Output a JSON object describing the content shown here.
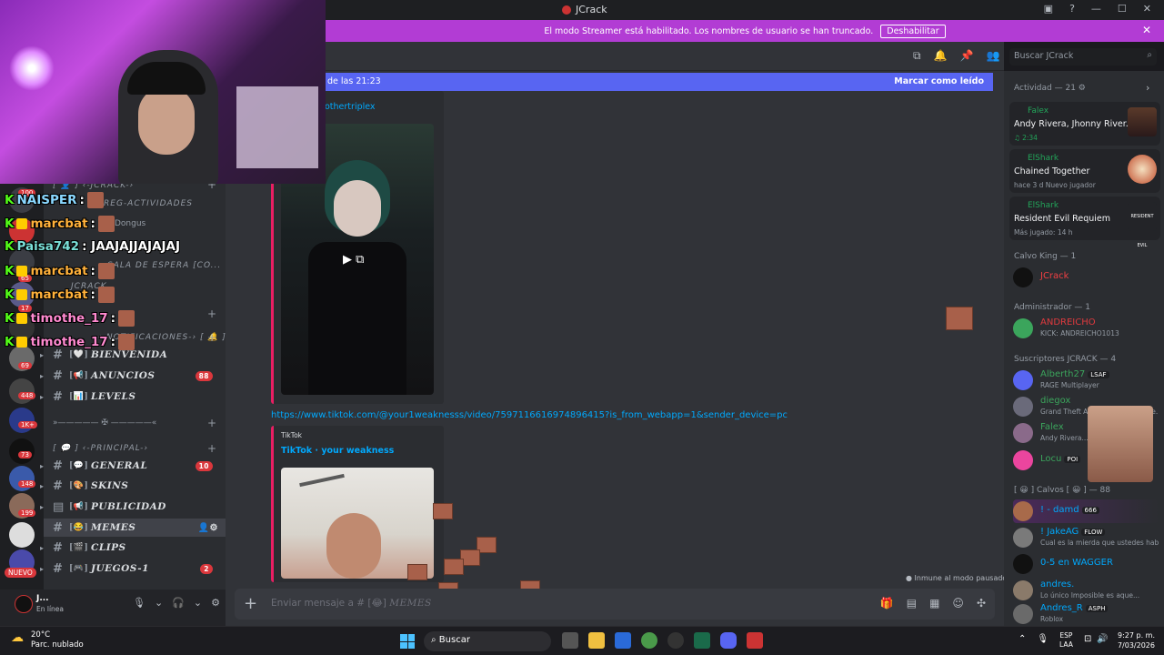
{
  "window": {
    "title": "JCrack"
  },
  "streamer_banner": {
    "text": "El modo Streamer está habilitado. Los nombres de usuario se han truncado.",
    "button": "Deshabilitar"
  },
  "new_messages_bar": {
    "left": "de las 21:23",
    "right": "Marcar como leído"
  },
  "channels": {
    "categories": [
      {
        "label": "[ 👤 ] ‹-JCRACK-›"
      },
      {
        "label": "»————— ✠ —————«"
      },
      {
        "label": "[ 💬 ] ‹-PRINCIPAL-›"
      }
    ],
    "voice": [
      {
        "label": "REG-ACTIVIDADES"
      },
      {
        "label": "Dongus"
      },
      {
        "label": "SALA DE ESPERA [CO..."
      },
      {
        "label": "JCRACK"
      },
      {
        "label": "‹-NOTIFICACIONES-› [ 🔔 ]"
      }
    ],
    "items": [
      {
        "label": "BIENVENIDA",
        "emoji": "[🤍]",
        "badge": ""
      },
      {
        "label": "ANUNCIOS",
        "emoji": "[📢]",
        "badge": "88"
      },
      {
        "label": "LEVELS",
        "emoji": "[📊]",
        "badge": ""
      },
      {
        "label": "GENERAL",
        "emoji": "[💬]",
        "badge": "10"
      },
      {
        "label": "SKINS",
        "emoji": "[🎨]",
        "badge": ""
      },
      {
        "label": "PUBLICIDAD",
        "emoji": "[📢]",
        "badge": ""
      },
      {
        "label": "MEMES",
        "emoji": "[😂]",
        "badge": ""
      },
      {
        "label": "CLIPS",
        "emoji": "[🎬]",
        "badge": ""
      },
      {
        "label": "JUEGOS-1",
        "emoji": "[🎮]",
        "badge": "2"
      }
    ]
  },
  "server_badges": [
    "100",
    "65",
    "17",
    "69",
    "448",
    "1K+",
    "73",
    "148",
    "199",
    "NUEVO"
  ],
  "user_panel": {
    "name": "J...",
    "status": "En línea"
  },
  "chat": {
    "embed1_user": "othertriplex",
    "link": "https://www.tiktok.com/@your1weaknesss/video/7597116616974896415?is_from_webapp=1&sender_device=pc",
    "embed2_provider": "TikTok",
    "embed2_title": "TikTok · your weakness",
    "composer_placeholder": "Enviar mensaje a #",
    "composer_channel": "MEMES",
    "slowmode": "Inmune al modo pausado"
  },
  "search": {
    "placeholder": "Buscar JCrack"
  },
  "members": {
    "activity_header": "Actividad — 21",
    "activities": [
      {
        "user": "Falex",
        "game": "Andy Rivera, Jhonny River...",
        "meta": "♫ 2:34"
      },
      {
        "user": "ElShark",
        "game": "Chained Together",
        "meta": "hace 3 d   Nuevo jugador"
      },
      {
        "user": "ElShark",
        "game": "Resident Evil Requiem",
        "meta": "Más jugado: 14 h"
      }
    ],
    "sections": [
      {
        "header": "Calvo King — 1"
      },
      {
        "header": "Administrador — 1"
      },
      {
        "header": "Suscriptores JCRACK — 4"
      },
      {
        "header": "[ 😀 ] Calvos [ 😀 ] — 88"
      }
    ],
    "list": [
      {
        "name": "JCrack",
        "sub": "",
        "tag": "",
        "color": "#f23f43"
      },
      {
        "name": "ANDREICHO",
        "sub": "KICK: ANDREICHO1013",
        "tag": "",
        "color": "#e03a3e"
      },
      {
        "name": "Alberth27",
        "sub": "RAGE Multiplayer",
        "tag": "LSAF",
        "color": "#3ba55c"
      },
      {
        "name": "diegox",
        "sub": "Grand Theft Auto Online (Xbox Se...",
        "tag": "",
        "color": "#3ba55c"
      },
      {
        "name": "Falex",
        "sub": "Andy Rivera...",
        "tag": "",
        "color": "#3ba55c"
      },
      {
        "name": "Locu",
        "sub": "",
        "tag": "POI",
        "color": "#3ba55c"
      },
      {
        "name": "! - damd",
        "sub": "",
        "tag": "666",
        "color": "#00a8fc"
      },
      {
        "name": "! JakeAG",
        "sub": "Cual es la mierda que ustedes habl...",
        "tag": "FLOW",
        "color": "#00a8fc"
      },
      {
        "name": "0-5 en WAGGER",
        "sub": "",
        "tag": "",
        "color": "#00a8fc"
      },
      {
        "name": "andres.",
        "sub": "Lo único Imposible es aque...",
        "tag": "",
        "color": "#00a8fc"
      },
      {
        "name": "Andres_R",
        "sub": "Roblox",
        "tag": "ASPH",
        "color": "#00a8fc"
      }
    ]
  },
  "stream_chat": [
    {
      "user": "NAISPER",
      "msg": ":",
      "color": "#8ad8ff"
    },
    {
      "user": "marcbat",
      "msg": ":",
      "color": "#ffb13b"
    },
    {
      "user": "Paisa742",
      "msg": ": JAAJAJJAJAJAJ",
      "color": "#7ae0d8"
    },
    {
      "user": "marcbat",
      "msg": ":",
      "color": "#ffb13b"
    },
    {
      "user": "marcbat",
      "msg": ":",
      "color": "#ffb13b"
    },
    {
      "user": "timothe_17",
      "msg": ":",
      "color": "#ff8ad0"
    },
    {
      "user": "timothe_17",
      "msg": ":",
      "color": "#ff8ad0"
    }
  ],
  "taskbar": {
    "temp": "20°C",
    "weather": "Parc. nublado",
    "search": "Buscar",
    "lang1": "ESP",
    "lang2": "LAA",
    "time": "9:27 p. m.",
    "date": "7/03/2026"
  }
}
